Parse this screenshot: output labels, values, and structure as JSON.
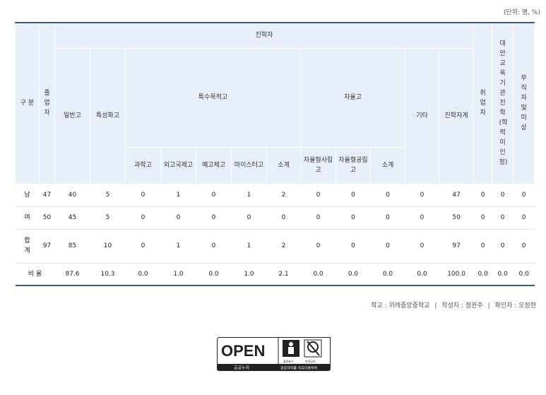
{
  "unit": "(단위: 명, %)",
  "header": {
    "category": "구 분",
    "graduates": "졸업자",
    "advancement": "진학자",
    "general_high": "일반고",
    "specialized_high": "특성화고",
    "special_purpose": "특수목적고",
    "autonomous": "자율고",
    "other": "기타",
    "advancement_total": "진학자계",
    "employed": "취업자",
    "alt_edu": "대안교육기관진학(학력미인정)",
    "unemployed": "무직자및미상",
    "science": "과학고",
    "foreign_lang": "외고국제고",
    "arts_sports": "예고체고",
    "meister": "마이스터고",
    "subtotal1": "소계",
    "autonomous_private": "자율형사립고",
    "autonomous_public": "자율형공립고",
    "subtotal2": "소계"
  },
  "rows": [
    {
      "label": "남",
      "cells": [
        "47",
        "40",
        "5",
        "0",
        "1",
        "0",
        "1",
        "2",
        "0",
        "0",
        "0",
        "0",
        "47",
        "0",
        "0",
        "0"
      ]
    },
    {
      "label": "여",
      "cells": [
        "50",
        "45",
        "5",
        "0",
        "0",
        "0",
        "0",
        "0",
        "0",
        "0",
        "0",
        "0",
        "50",
        "0",
        "0",
        "0"
      ]
    },
    {
      "label": "합계",
      "cells": [
        "97",
        "85",
        "10",
        "0",
        "1",
        "0",
        "1",
        "2",
        "0",
        "0",
        "0",
        "0",
        "97",
        "0",
        "0",
        "0"
      ]
    }
  ],
  "ratio": {
    "label": "비 율",
    "cells": [
      "87.6",
      "10.3",
      "0.0",
      "1.0",
      "0.0",
      "1.0",
      "2.1",
      "0.0",
      "0.0",
      "0.0",
      "0.0",
      "100.0",
      "0.0",
      "0.0",
      "0.0"
    ]
  },
  "footer": {
    "school": "학교 : 위례중앙중학교",
    "author": "작성자 : 정완주",
    "checker": "확인자 : 오정현",
    "sep": "|"
  },
  "logo": {
    "open": "OPEN",
    "left_caption": "공공누리",
    "right_caption": "공공저작물 자유이용허락",
    "badge1": "출처표시",
    "badge2": "변경금지"
  }
}
